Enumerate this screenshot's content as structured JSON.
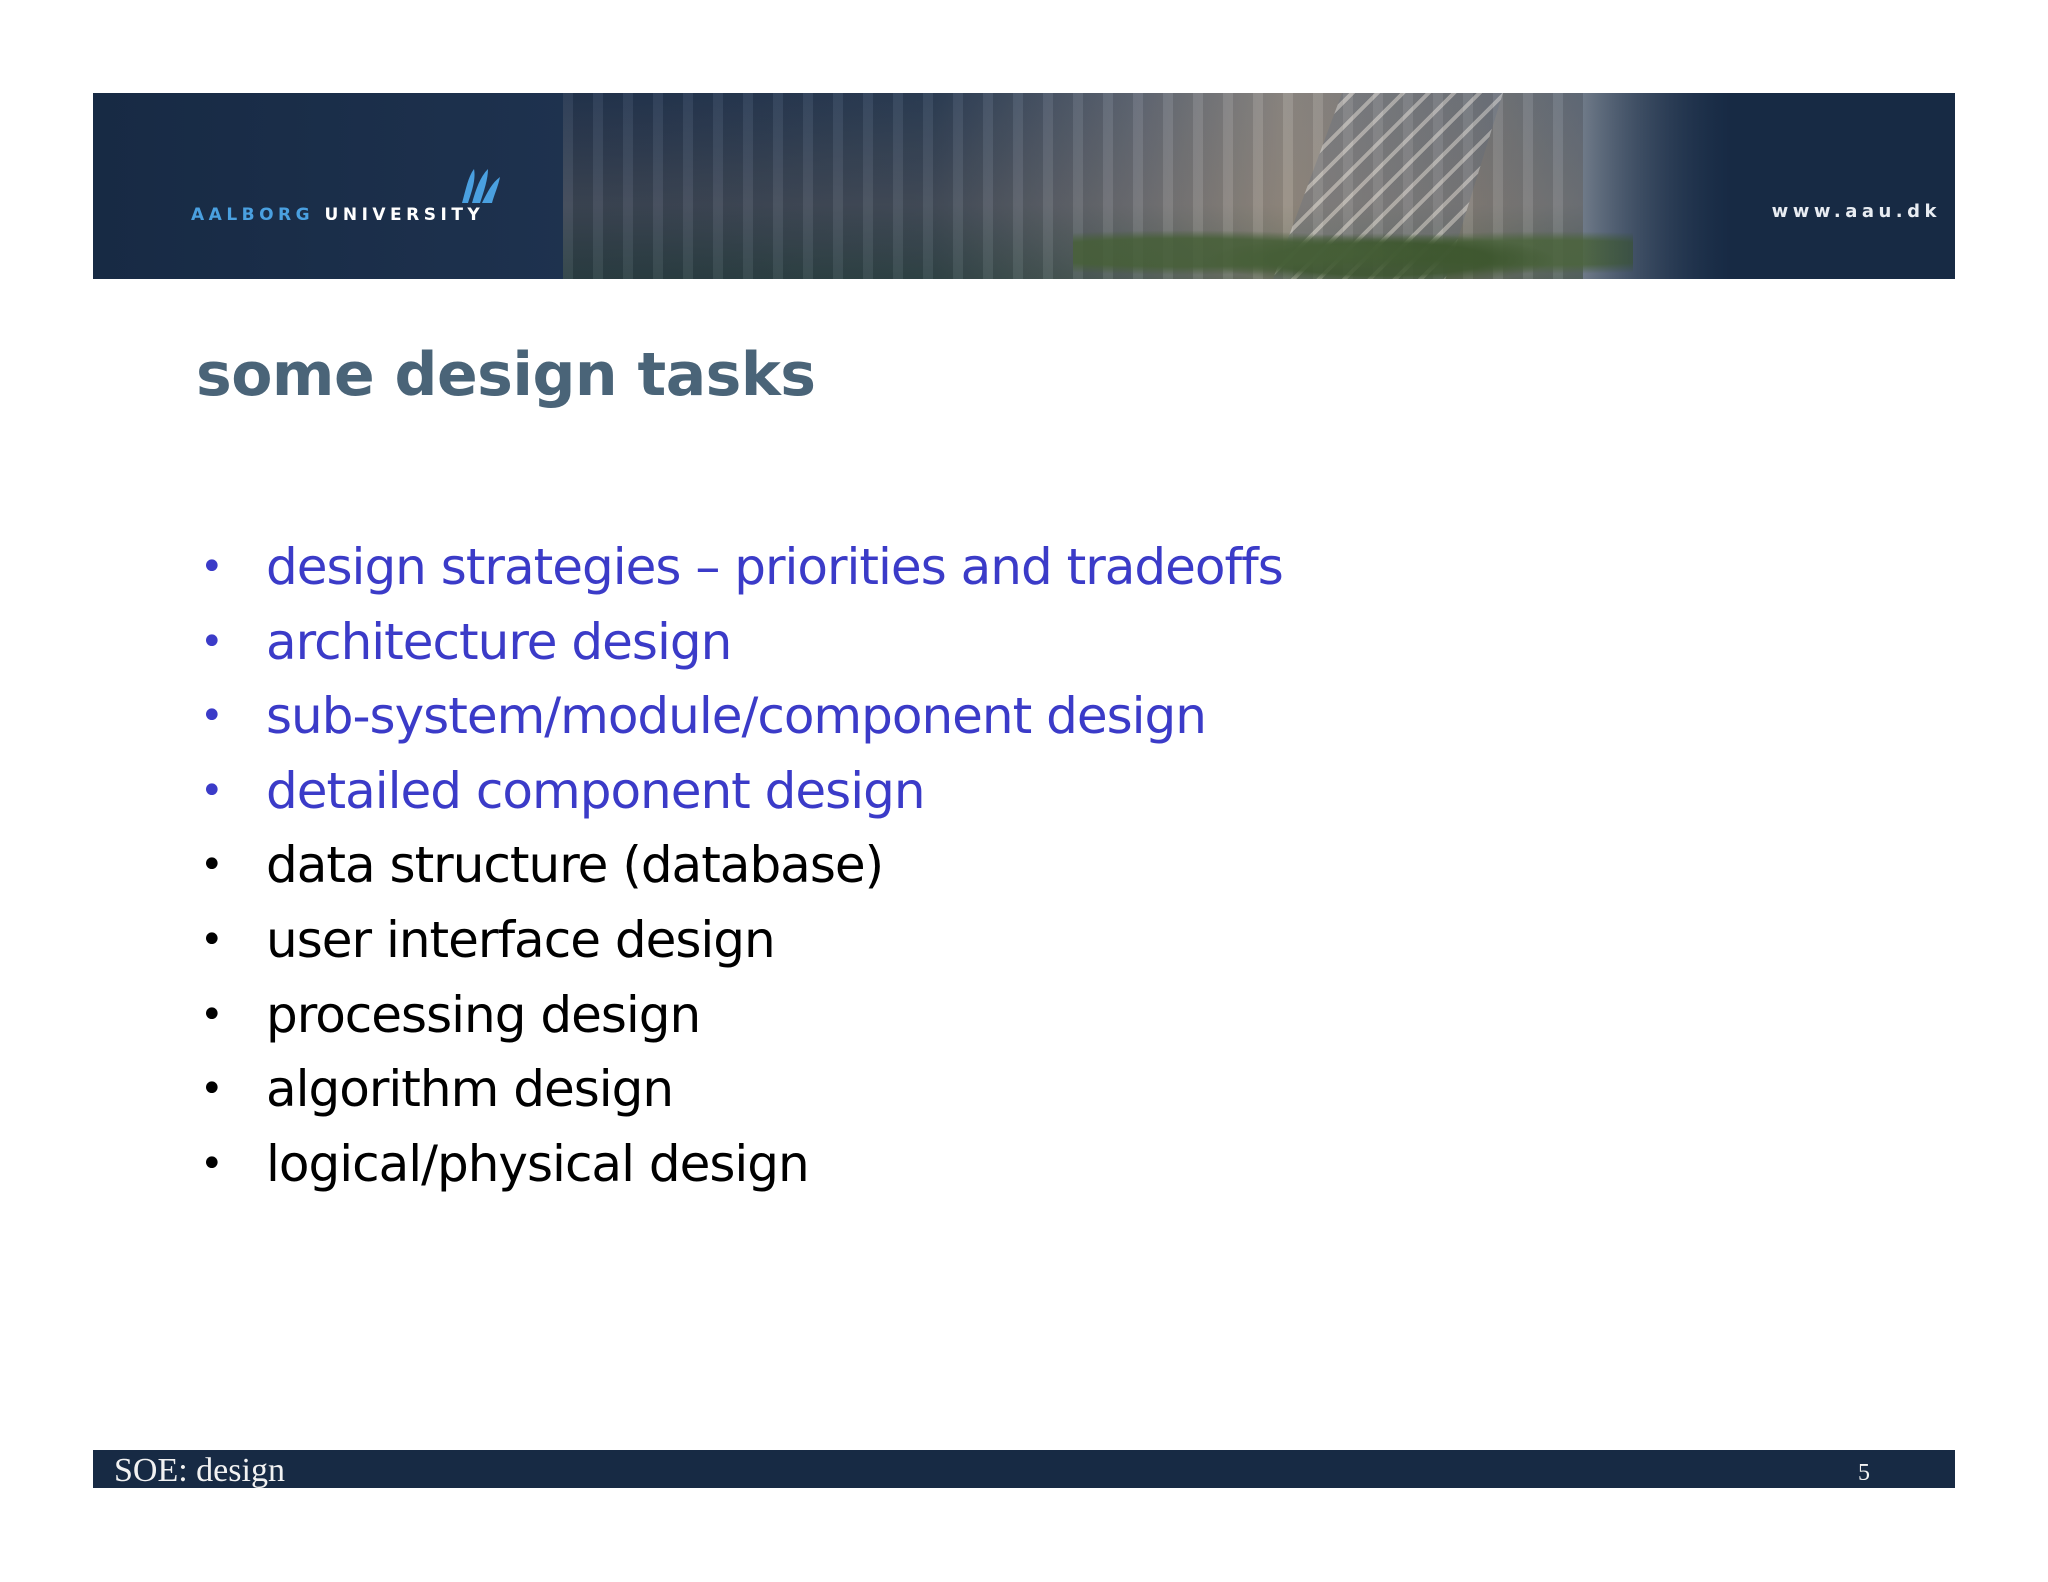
{
  "header": {
    "brand_part1": "AALBORG",
    "brand_part2": "UNIVERSITY",
    "website": "www.aau.dk",
    "logo_icon": "aau-logo-icon"
  },
  "slide": {
    "title": "some design tasks",
    "bullets": [
      {
        "text": "design strategies – priorities and tradeoffs",
        "color": "#3b3bc8"
      },
      {
        "text": "architecture design",
        "color": "#3b3bc8"
      },
      {
        "text": "sub-system/module/component design",
        "color": "#3b3bc8"
      },
      {
        "text": "detailed component design",
        "color": "#3b3bc8"
      },
      {
        "text": "data structure (database)",
        "color": "#000000"
      },
      {
        "text": "user interface design",
        "color": "#000000"
      },
      {
        "text": "processing design",
        "color": "#000000"
      },
      {
        "text": "algorithm design",
        "color": "#000000"
      },
      {
        "text": "logical/physical design",
        "color": "#000000"
      }
    ]
  },
  "footer": {
    "left": "SOE: design",
    "page_number": "5"
  },
  "colors": {
    "banner": "#172a44",
    "title": "#4a6478",
    "accent_blue": "#3b3bc8",
    "brand_blue": "#4aa0e0"
  }
}
